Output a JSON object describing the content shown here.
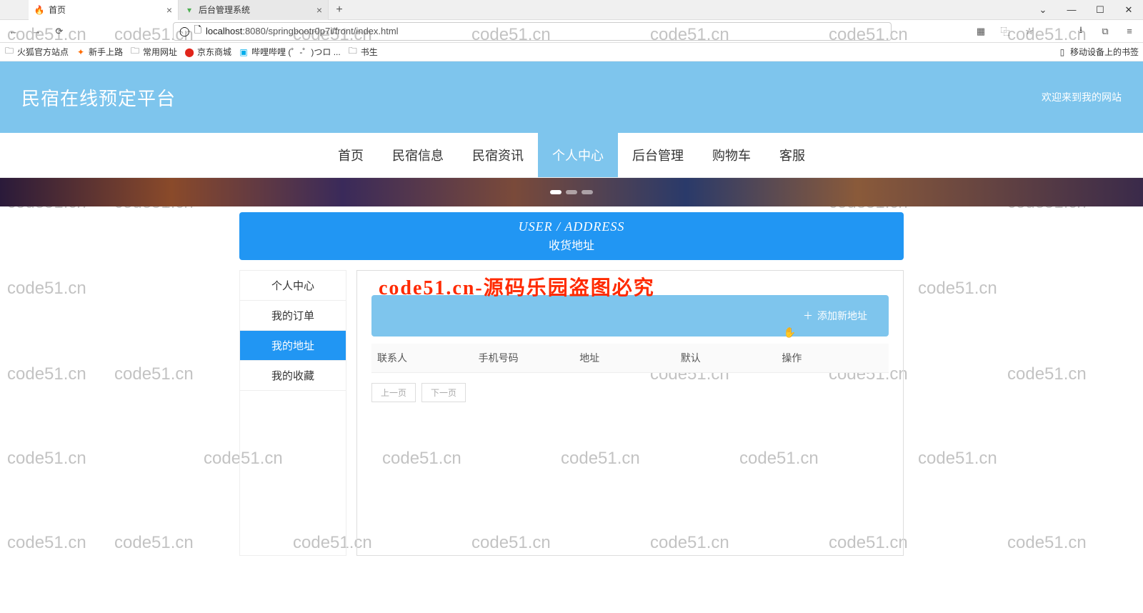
{
  "watermark_text": "code51.cn",
  "browser": {
    "tabs": [
      {
        "title": "首页",
        "active": true
      },
      {
        "title": "后台管理系统",
        "active": false
      }
    ],
    "url_display": {
      "host": "localhost",
      "path": ":8080/springbootr0p7i/front/index.html"
    },
    "bookmarks": [
      {
        "label": "火狐官方站点",
        "icon": "folder"
      },
      {
        "label": "新手上路",
        "icon": "star"
      },
      {
        "label": "常用网址",
        "icon": "folder"
      },
      {
        "label": "京东商城",
        "icon": "jd"
      },
      {
        "label": "哔哩哔哩 (゜-゜)つロ ...",
        "icon": "bili"
      },
      {
        "label": "书生",
        "icon": "folder"
      }
    ],
    "mobile_bookmarks": "移动设备上的书签"
  },
  "site": {
    "title": "民宿在线预定平台",
    "welcome": "欢迎来到我的网站",
    "nav": [
      {
        "label": "首页",
        "active": false
      },
      {
        "label": "民宿信息",
        "active": false
      },
      {
        "label": "民宿资讯",
        "active": false
      },
      {
        "label": "个人中心",
        "active": true
      },
      {
        "label": "后台管理",
        "active": false
      },
      {
        "label": "购物车",
        "active": false
      },
      {
        "label": "客服",
        "active": false
      }
    ]
  },
  "section": {
    "en": "USER / ADDRESS",
    "cn": "收货地址"
  },
  "sidebar": [
    {
      "label": "个人中心",
      "active": false
    },
    {
      "label": "我的订单",
      "active": false
    },
    {
      "label": "我的地址",
      "active": true
    },
    {
      "label": "我的收藏",
      "active": false
    }
  ],
  "overlay": "code51.cn-源码乐园盗图必究",
  "addButton": "添加新地址",
  "table": {
    "columns": [
      "联系人",
      "手机号码",
      "地址",
      "默认",
      "操作"
    ]
  },
  "pager": {
    "prev": "上一页",
    "next": "下一页"
  }
}
